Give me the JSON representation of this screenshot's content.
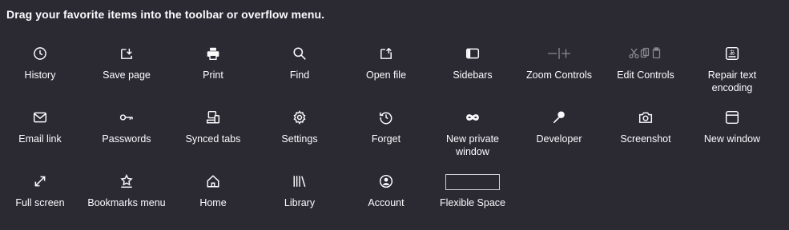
{
  "heading": "Drag your favorite items into the toolbar or overflow menu.",
  "items": [
    {
      "label": "History",
      "icon": "clock-icon"
    },
    {
      "label": "Save page",
      "icon": "save-page-icon"
    },
    {
      "label": "Print",
      "icon": "printer-icon"
    },
    {
      "label": "Find",
      "icon": "search-icon"
    },
    {
      "label": "Open file",
      "icon": "open-file-icon"
    },
    {
      "label": "Sidebars",
      "icon": "sidebar-icon"
    },
    {
      "label": "Zoom Controls",
      "icon": "zoom-controls-icon"
    },
    {
      "label": "Edit Controls",
      "icon": "edit-controls-icon"
    },
    {
      "label": "Repair text encoding",
      "icon": "text-encoding-icon"
    },
    {
      "label": "Email link",
      "icon": "email-icon"
    },
    {
      "label": "Passwords",
      "icon": "key-icon"
    },
    {
      "label": "Synced tabs",
      "icon": "synced-tabs-icon"
    },
    {
      "label": "Settings",
      "icon": "gear-icon"
    },
    {
      "label": "Forget",
      "icon": "forget-icon"
    },
    {
      "label": "New private window",
      "icon": "private-mask-icon"
    },
    {
      "label": "Developer",
      "icon": "wrench-icon"
    },
    {
      "label": "Screenshot",
      "icon": "camera-icon"
    },
    {
      "label": "New window",
      "icon": "new-window-icon"
    },
    {
      "label": "Full screen",
      "icon": "fullscreen-icon"
    },
    {
      "label": "Bookmarks menu",
      "icon": "bookmarks-menu-icon"
    },
    {
      "label": "Home",
      "icon": "home-icon"
    },
    {
      "label": "Library",
      "icon": "library-icon"
    },
    {
      "label": "Account",
      "icon": "account-icon"
    },
    {
      "label": "Flexible Space",
      "icon": "flexible-space-box"
    }
  ]
}
